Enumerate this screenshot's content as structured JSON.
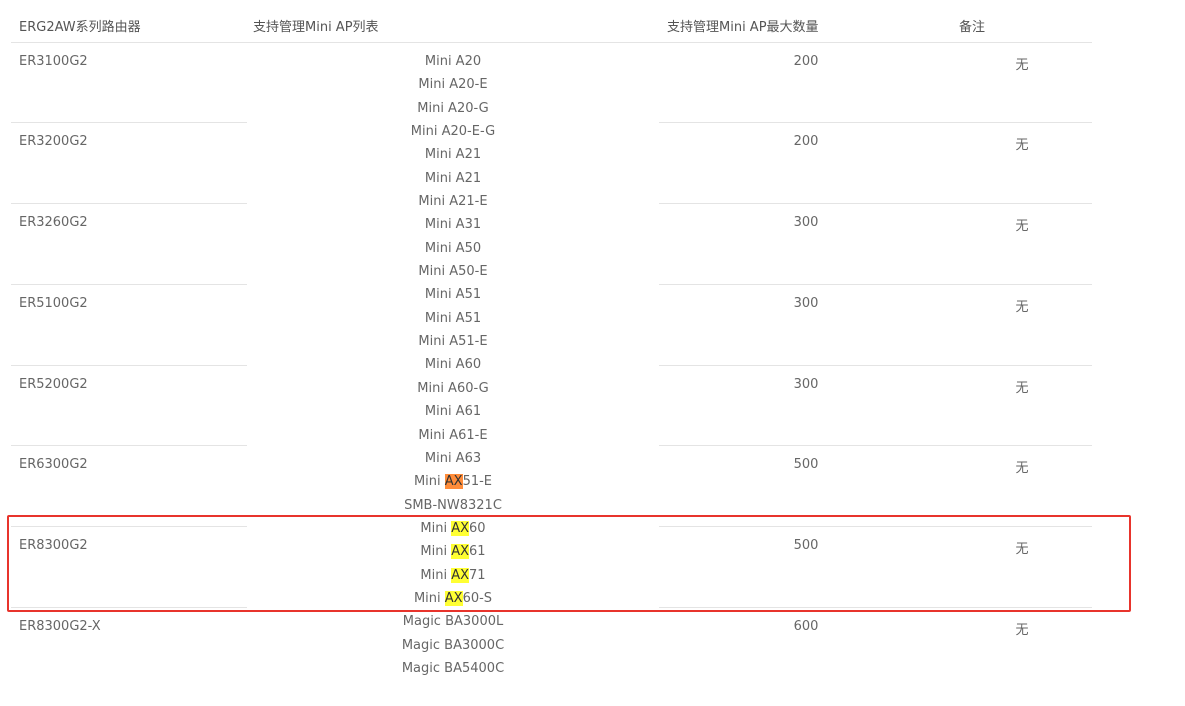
{
  "headers": {
    "router_series": "ERG2AW系列路由器",
    "ap_list": "支持管理Mini AP列表",
    "max_count": "支持管理Mini AP最大数量",
    "notes": "备注"
  },
  "rows": [
    {
      "model": "ER3100G2",
      "max": "200",
      "note": "无"
    },
    {
      "model": "ER3200G2",
      "max": "200",
      "note": "无"
    },
    {
      "model": "ER3260G2",
      "max": "300",
      "note": "无"
    },
    {
      "model": "ER5100G2",
      "max": "300",
      "note": "无"
    },
    {
      "model": "ER5200G2",
      "max": "300",
      "note": "无"
    },
    {
      "model": "ER6300G2",
      "max": "500",
      "note": "无"
    },
    {
      "model": "ER8300G2",
      "max": "500",
      "note": "无"
    },
    {
      "model": "ER8300G2-X",
      "max": "600",
      "note": "无"
    }
  ],
  "ap_models": [
    "Mini A20",
    "Mini A20-E",
    "Mini A20-G",
    "Mini A20-E-G",
    "Mini A21",
    "Mini A21",
    "Mini A21-E",
    "Mini A31",
    "Mini A50",
    "Mini A50-E",
    "Mini A51",
    "Mini A51",
    "Mini A51-E",
    "Mini A60",
    "Mini A60-G",
    "Mini A61",
    "Mini A61-E",
    "Mini A63",
    {
      "pre": "Mini ",
      "hl": "AX",
      "post": "51-E",
      "hl_color": "#ff8c3a"
    },
    "SMB-NW8321C",
    {
      "pre": "Mini ",
      "hl": "AX",
      "post": "60",
      "hl_color": "#ffff33"
    },
    {
      "pre": "Mini ",
      "hl": "AX",
      "post": "61",
      "hl_color": "#ffff33"
    },
    {
      "pre": "Mini ",
      "hl": "AX",
      "post": "71",
      "hl_color": "#ffff33"
    },
    {
      "pre": "Mini ",
      "hl": "AX",
      "post": "60-S",
      "hl_color": "#ffff33"
    },
    "Magic BA3000L",
    "Magic BA3000C",
    "Magic BA5400C"
  ],
  "highlight_box_color": "#e8342c"
}
